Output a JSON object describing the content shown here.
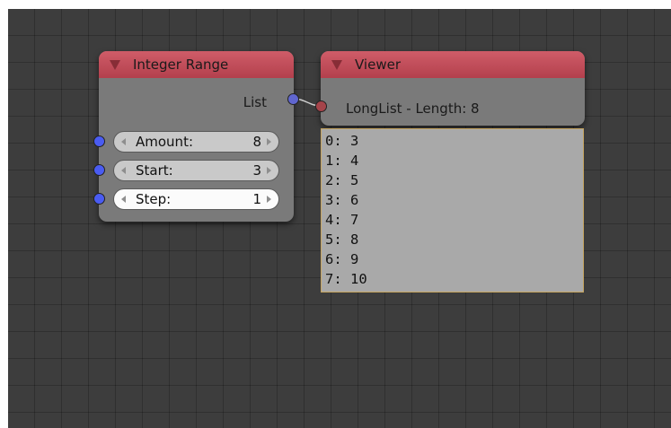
{
  "integer_range_node": {
    "title": "Integer Range",
    "output_label": "List",
    "inputs": [
      {
        "name": "Amount:",
        "value": "8"
      },
      {
        "name": "Start:",
        "value": "3"
      },
      {
        "name": "Step:",
        "value": "1"
      }
    ]
  },
  "viewer_node": {
    "title": "Viewer",
    "input_label": "LongList - Length: 8",
    "lines": [
      "0: 3",
      "1: 4",
      "2: 5",
      "3: 6",
      "4: 7",
      "5: 8",
      "6: 9",
      "7: 10"
    ]
  },
  "colors": {
    "header": "#c24b58",
    "node_body": "#7a7a7a",
    "grid_background": "#3d3d3d",
    "int_socket": "#4a5cf2",
    "generic_socket": "#a5444a",
    "viewer_border": "#c6a560"
  }
}
